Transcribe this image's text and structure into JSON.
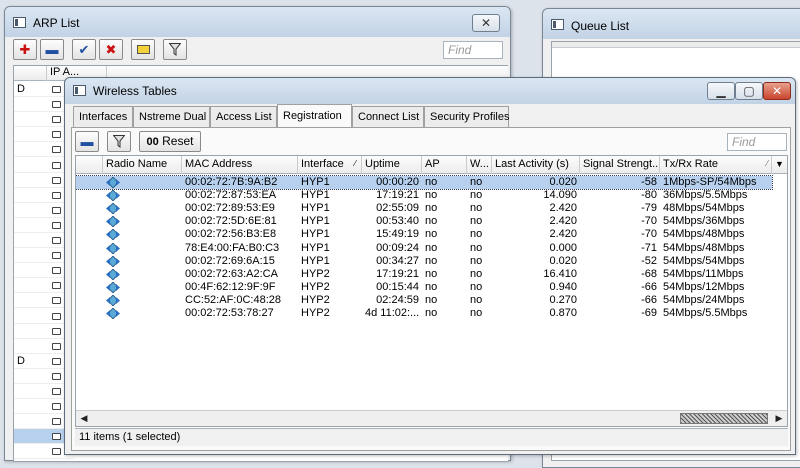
{
  "arp": {
    "title": "ARP List",
    "find_placeholder": "Find",
    "header_col": "IP A...",
    "left_rows": [
      "D",
      "",
      "",
      "",
      "",
      "",
      "",
      "",
      "",
      "",
      "",
      "",
      "",
      "",
      "",
      "",
      "",
      "",
      "",
      "",
      "",
      "",
      "",
      "",
      "",
      ""
    ],
    "left_flags": {
      "0": "D",
      "18": "D"
    }
  },
  "queue": {
    "title": "Queue List"
  },
  "wireless": {
    "title": "Wireless Tables",
    "tabs": [
      "Interfaces",
      "Nstreme Dual",
      "Access List",
      "Registration",
      "Connect List",
      "Security Profiles"
    ],
    "active_tab": "Registration",
    "reset_label": "Reset",
    "reset_prefix": "00",
    "find_placeholder": "Find",
    "columns": [
      "Radio Name",
      "MAC Address",
      "Interface",
      "Uptime",
      "AP",
      "W...",
      "Last Activity (s)",
      "Signal Strengt...",
      "Tx/Rx Rate"
    ],
    "rows": [
      {
        "mac": "00:02:72:7B:9A:B2",
        "iface": "HYP1",
        "uptime": "00:00:20",
        "ap": "no",
        "w": "no",
        "last": "0.020",
        "signal": "-58",
        "rate": "1Mbps-SP/54Mbps"
      },
      {
        "mac": "00:02:72:87:53:EA",
        "iface": "HYP1",
        "uptime": "17:19:21",
        "ap": "no",
        "w": "no",
        "last": "14.090",
        "signal": "-80",
        "rate": "36Mbps/5.5Mbps"
      },
      {
        "mac": "00:02:72:89:53:E9",
        "iface": "HYP1",
        "uptime": "02:55:09",
        "ap": "no",
        "w": "no",
        "last": "2.420",
        "signal": "-79",
        "rate": "48Mbps/54Mbps"
      },
      {
        "mac": "00:02:72:5D:6E:81",
        "iface": "HYP1",
        "uptime": "00:53:40",
        "ap": "no",
        "w": "no",
        "last": "2.420",
        "signal": "-70",
        "rate": "54Mbps/36Mbps"
      },
      {
        "mac": "00:02:72:56:B3:E8",
        "iface": "HYP1",
        "uptime": "15:49:19",
        "ap": "no",
        "w": "no",
        "last": "2.420",
        "signal": "-70",
        "rate": "54Mbps/48Mbps"
      },
      {
        "mac": "78:E4:00:FA:B0:C3",
        "iface": "HYP1",
        "uptime": "00:09:24",
        "ap": "no",
        "w": "no",
        "last": "0.000",
        "signal": "-71",
        "rate": "54Mbps/48Mbps"
      },
      {
        "mac": "00:02:72:69:6A:15",
        "iface": "HYP1",
        "uptime": "00:34:27",
        "ap": "no",
        "w": "no",
        "last": "0.020",
        "signal": "-52",
        "rate": "54Mbps/54Mbps"
      },
      {
        "mac": "00:02:72:63:A2:CA",
        "iface": "HYP2",
        "uptime": "17:19:21",
        "ap": "no",
        "w": "no",
        "last": "16.410",
        "signal": "-68",
        "rate": "54Mbps/11Mbps"
      },
      {
        "mac": "00:4F:62:12:9F:9F",
        "iface": "HYP2",
        "uptime": "00:15:44",
        "ap": "no",
        "w": "no",
        "last": "0.940",
        "signal": "-66",
        "rate": "54Mbps/12Mbps"
      },
      {
        "mac": "CC:52:AF:0C:48:28",
        "iface": "HYP2",
        "uptime": "02:24:59",
        "ap": "no",
        "w": "no",
        "last": "0.270",
        "signal": "-66",
        "rate": "54Mbps/24Mbps"
      },
      {
        "mac": "00:02:72:53:78:27",
        "iface": "HYP2",
        "uptime": "4d 11:02:...",
        "ap": "no",
        "w": "no",
        "last": "0.870",
        "signal": "-69",
        "rate": "54Mbps/5.5Mbps"
      }
    ],
    "status": "11 items (1 selected)"
  },
  "colors": {
    "selection": "#b6d0ee",
    "close_button": "#c9452d",
    "icon_blue": "#2b6fc2",
    "icon_red": "#cc1111"
  }
}
